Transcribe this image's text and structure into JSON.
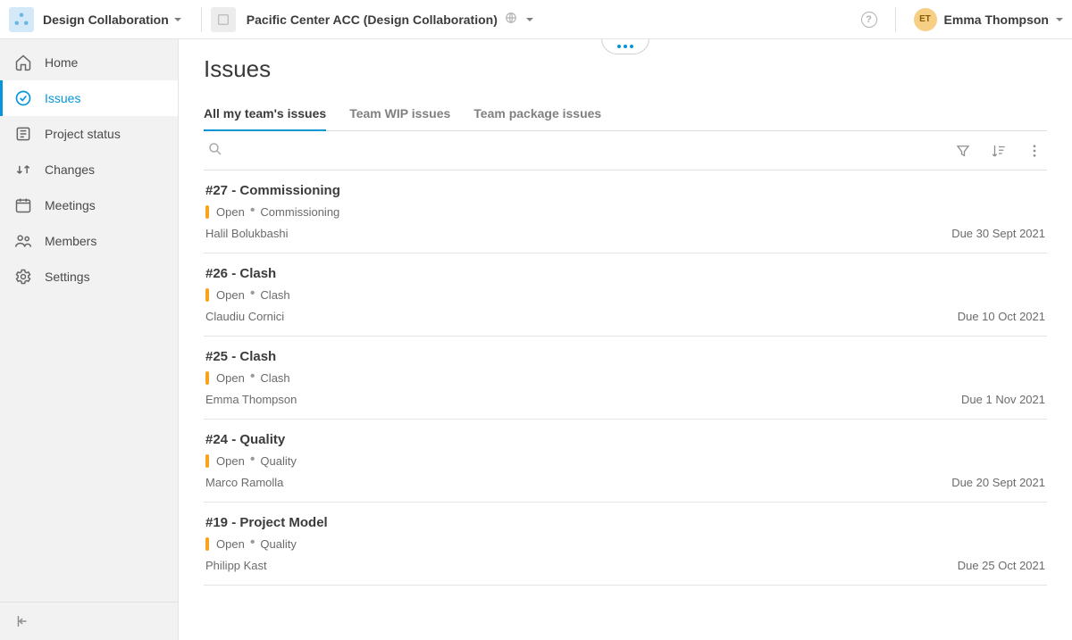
{
  "header": {
    "app_name": "Design Collaboration",
    "project_name": "Pacific Center ACC (Design Collaboration)",
    "user_name": "Emma Thompson",
    "user_initials": "ET"
  },
  "sidebar": {
    "items": [
      {
        "label": "Home",
        "icon": "home-icon"
      },
      {
        "label": "Issues",
        "icon": "check-circle-icon"
      },
      {
        "label": "Project status",
        "icon": "status-icon"
      },
      {
        "label": "Changes",
        "icon": "changes-icon"
      },
      {
        "label": "Meetings",
        "icon": "calendar-icon"
      },
      {
        "label": "Members",
        "icon": "members-icon"
      },
      {
        "label": "Settings",
        "icon": "gear-icon"
      }
    ],
    "active_index": 1
  },
  "page": {
    "title": "Issues",
    "tabs": [
      {
        "label": "All my team's issues"
      },
      {
        "label": "Team WIP issues"
      },
      {
        "label": "Team package issues"
      }
    ],
    "active_tab": 0,
    "status_color": "#faa21b",
    "issues": [
      {
        "title": "#27 - Commissioning",
        "status": "Open",
        "type": "Commissioning",
        "assignee": "Halil Bolukbashi",
        "due": "Due 30 Sept 2021"
      },
      {
        "title": "#26 - Clash",
        "status": "Open",
        "type": "Clash",
        "assignee": "Claudiu Cornici",
        "due": "Due 10 Oct 2021"
      },
      {
        "title": "#25 - Clash",
        "status": "Open",
        "type": "Clash",
        "assignee": "Emma Thompson",
        "due": "Due 1 Nov 2021"
      },
      {
        "title": "#24 - Quality",
        "status": "Open",
        "type": "Quality",
        "assignee": "Marco Ramolla",
        "due": "Due 20 Sept 2021"
      },
      {
        "title": "#19 - Project Model",
        "status": "Open",
        "type": "Quality",
        "assignee": "Philipp Kast",
        "due": "Due 25 Oct 2021"
      }
    ]
  }
}
